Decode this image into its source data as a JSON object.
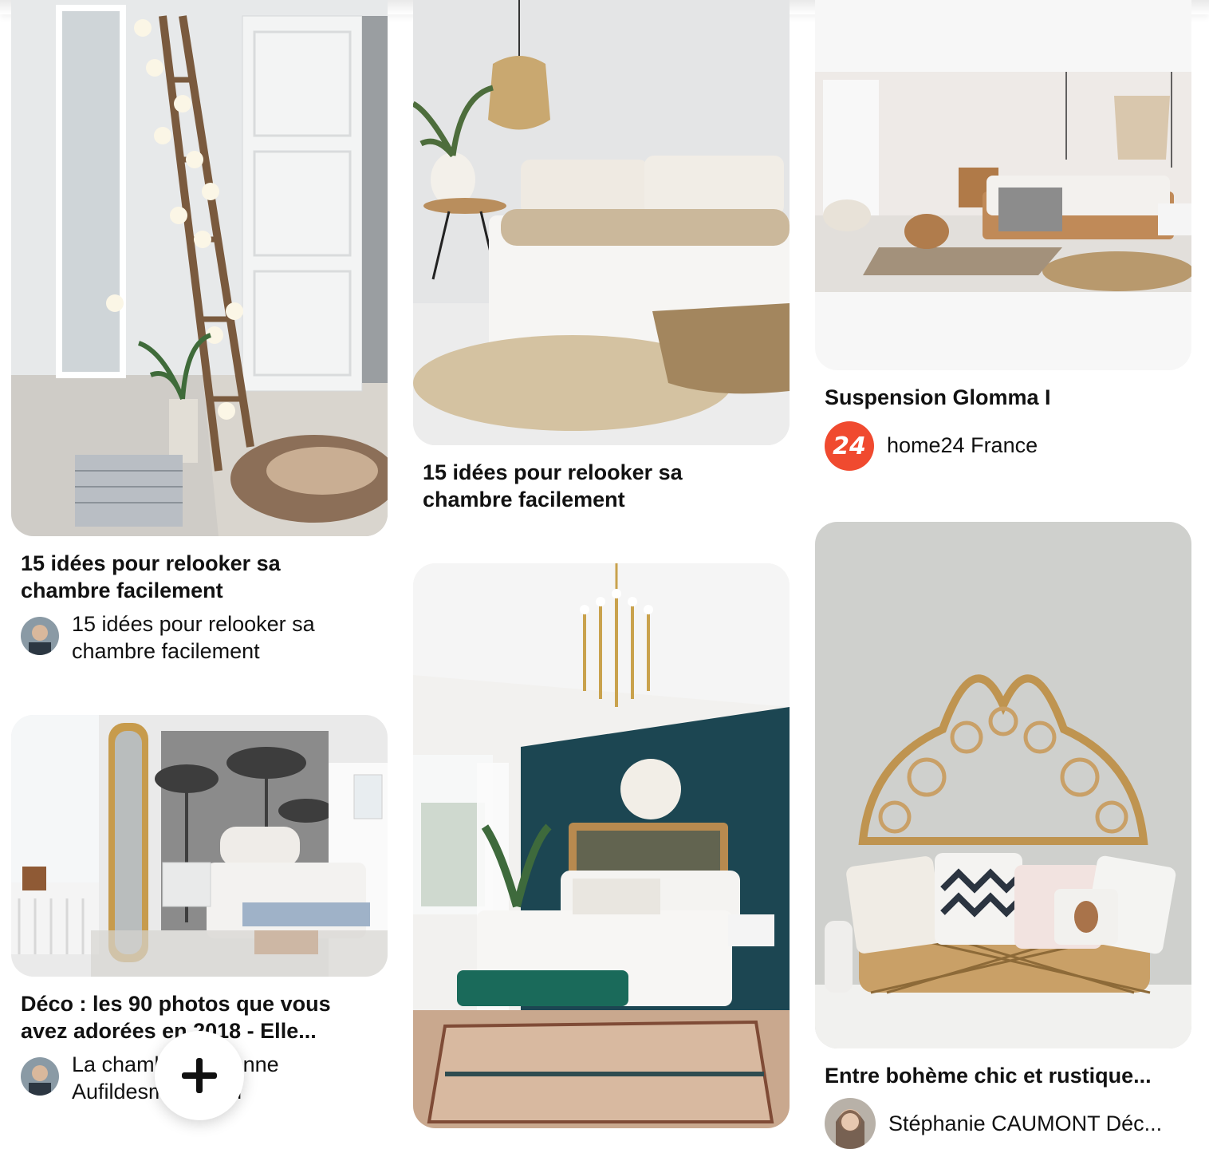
{
  "pins": [
    {
      "title": "15 idées pour relooker sa chambre facilement",
      "source": "15 idées pour relooker sa chambre facilement"
    },
    {
      "title": "15 idées pour relooker sa chambre facilement"
    },
    {
      "title": "Suspension Glomma I",
      "source": "home24 France",
      "badge": "24"
    },
    {
      "title": "Déco : les 90 photos que vous avez adorées en 2018 - Elle...",
      "source": "La chambre ancienne Aufildesmots.com"
    },
    {
      "title": "Entre bohème chic et rustique...",
      "source": "Stéphanie CAUMONT Déc..."
    }
  ],
  "fab": {
    "icon": "plus-icon"
  }
}
